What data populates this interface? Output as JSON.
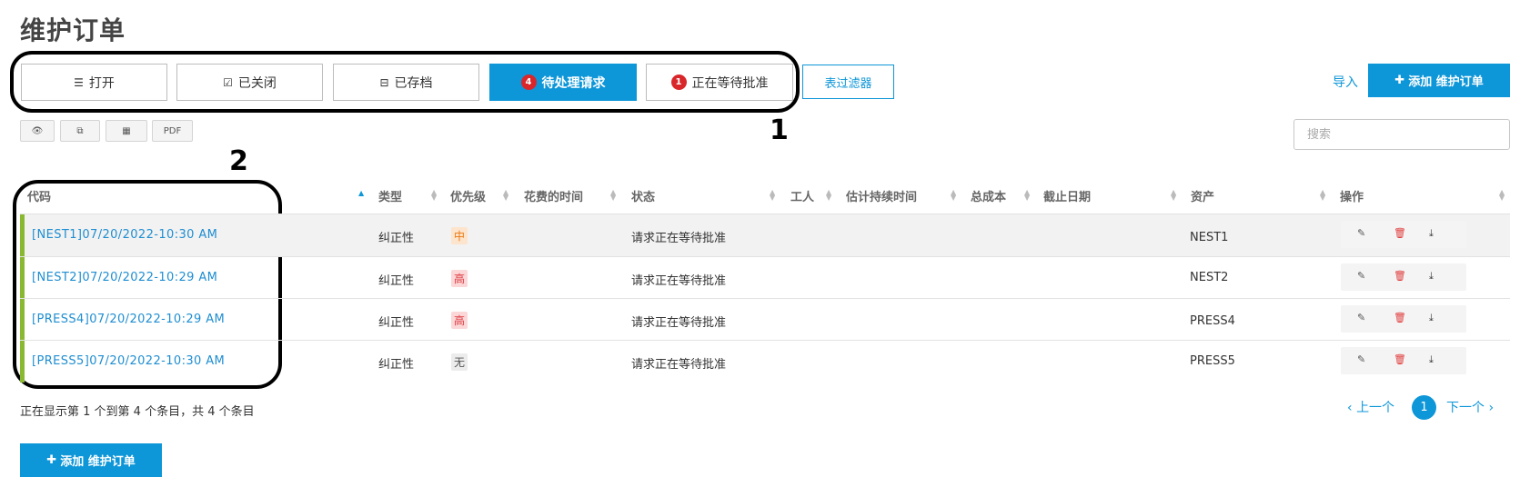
{
  "page": {
    "title": "维护订单"
  },
  "tabs": [
    {
      "label": "打开",
      "icon": "list-icon",
      "active": false,
      "badge": ""
    },
    {
      "label": "已关闭",
      "icon": "checkbox-icon",
      "active": false,
      "badge": ""
    },
    {
      "label": "已存档",
      "icon": "archive-icon",
      "active": false,
      "badge": ""
    },
    {
      "label": "待处理请求",
      "icon": "",
      "active": true,
      "badge": "4"
    },
    {
      "label": "正在等待批准",
      "icon": "",
      "active": false,
      "badge": "1"
    }
  ],
  "toolbar": {
    "filter_label": "表过滤器",
    "import_label": "导入",
    "add_label": "添加 维护订单",
    "tools": [
      "eye-icon",
      "copy-icon",
      "table-icon",
      "PDF"
    ],
    "search_placeholder": "搜索"
  },
  "annotations": {
    "one": "1",
    "two": "2"
  },
  "table": {
    "headers": [
      "代码",
      "类型",
      "优先级",
      "花费的时间",
      "状态",
      "工人",
      "估计持续时间",
      "总成本",
      "截止日期",
      "资产",
      "操作"
    ],
    "rows": [
      {
        "code": "[NEST1]07/20/2022-10:30 AM",
        "type": "纠正性",
        "priority": "中",
        "priority_level": "medium",
        "status": "请求正在等待批准",
        "asset": "NEST1"
      },
      {
        "code": "[NEST2]07/20/2022-10:29 AM",
        "type": "纠正性",
        "priority": "高",
        "priority_level": "high",
        "status": "请求正在等待批准",
        "asset": "NEST2"
      },
      {
        "code": "[PRESS4]07/20/2022-10:29 AM",
        "type": "纠正性",
        "priority": "高",
        "priority_level": "high",
        "status": "请求正在等待批准",
        "asset": "PRESS4"
      },
      {
        "code": "[PRESS5]07/20/2022-10:30 AM",
        "type": "纠正性",
        "priority": "无",
        "priority_level": "none",
        "status": "请求正在等待批准",
        "asset": "PRESS5"
      }
    ]
  },
  "footer": {
    "info": "正在显示第 1 个到第 4 个条目，共 4 个条目",
    "prev": "上一个",
    "page": "1",
    "next": "下一个",
    "add_label": "添加 维护订单"
  },
  "colors": {
    "accent": "#0d96d8",
    "badge": "#d9262b",
    "row_marker": "#8ab833"
  }
}
